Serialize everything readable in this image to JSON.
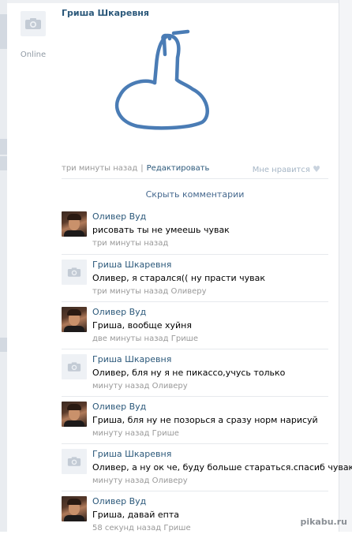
{
  "post": {
    "author": "Гриша Шкаревня",
    "status": "Online",
    "time": "три минуты назад",
    "separator": "|",
    "edit_label": "Редактировать",
    "like_label": "Мне нравится"
  },
  "hide_comments_label": "Скрыть комментарии",
  "comments": [
    {
      "author": "Оливер Вуд",
      "text": "рисовать ты не умеешь чувак",
      "time": "три минуты назад",
      "avatar": "photo"
    },
    {
      "author": "Гриша Шкаревня",
      "text": "Оливер, я старался(( ну прасти чувак",
      "time": "три минуты назад Оливеру",
      "avatar": "camera"
    },
    {
      "author": "Оливер Вуд",
      "text": "Гриша, вообще хуйня",
      "time": "две минуты назад Грише",
      "avatar": "photo"
    },
    {
      "author": "Гриша Шкаревня",
      "text": "Оливер, бля ну я не пикассо,учусь только",
      "time": "минуту назад Оливеру",
      "avatar": "camera"
    },
    {
      "author": "Оливер Вуд",
      "text": "Гриша, бля ну не позорься а сразу норм нарисуй",
      "time": "минуту назад Грише",
      "avatar": "photo"
    },
    {
      "author": "Гриша Шкаревня",
      "text": "Оливер, а ну ок че, буду больше стараться.спасиб чувак",
      "time": "минуту назад Оливеру",
      "avatar": "camera"
    },
    {
      "author": "Оливер Вуд",
      "text": "Гриша, давай епта",
      "time": "58 секунд назад Грише",
      "avatar": "photo"
    }
  ],
  "watermark": "pikabu.ru",
  "colors": {
    "link": "#2b587a",
    "muted": "#999999",
    "drawing_stroke": "#4a7cb5"
  }
}
